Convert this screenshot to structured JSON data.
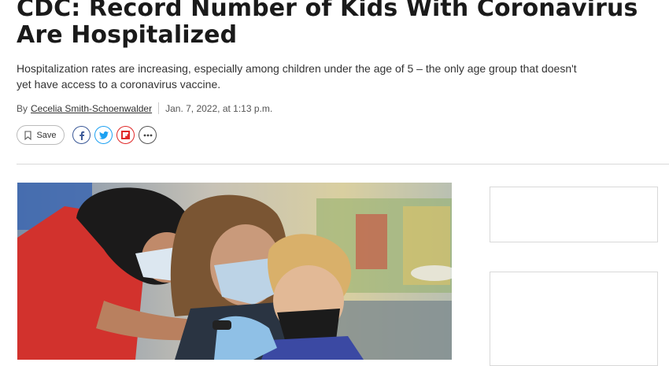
{
  "article": {
    "headline": "CDC: Record Number of Kids With Coronavirus Are Hospitalized",
    "dek": "Hospitalization rates are increasing, especially among children under the age of 5 – the only age group that doesn't yet have access to a coronavirus vaccine.",
    "byline_prefix": "By",
    "author": "Cecelia Smith-Schoenwalder",
    "date": "Jan. 7, 2022, at 1:13 p.m."
  },
  "actions": {
    "save_label": "Save",
    "share": [
      {
        "name": "facebook-share-button",
        "icon": "facebook-icon",
        "color": "#3b5998"
      },
      {
        "name": "twitter-share-button",
        "icon": "twitter-icon",
        "color": "#1da1f2"
      },
      {
        "name": "flipboard-share-button",
        "icon": "flipboard-icon",
        "color": "#e02828"
      },
      {
        "name": "more-share-button",
        "icon": "more-icon",
        "color": "#555555"
      }
    ]
  },
  "image": {
    "description": "photo-child-vaccination"
  }
}
